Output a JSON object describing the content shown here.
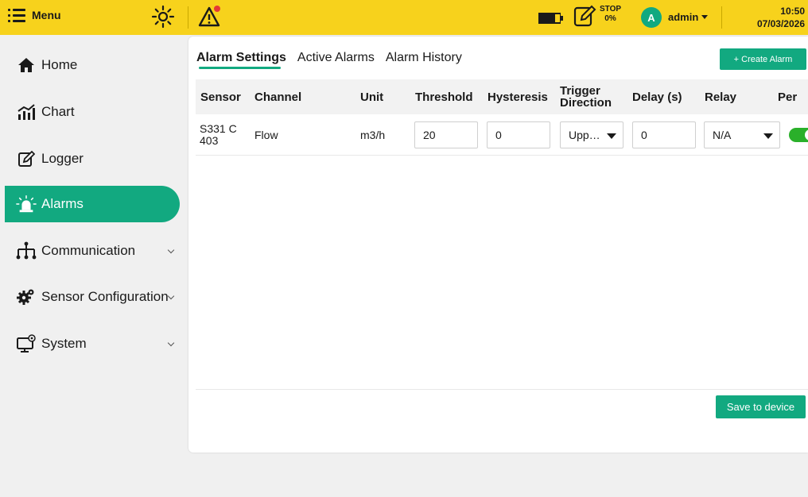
{
  "topbar": {
    "menu_label": "Menu",
    "recording_status": "STOP",
    "recording_percent": "0%",
    "avatar_initial": "A",
    "username": "admin",
    "time": "10:50",
    "date": "07/03/2026",
    "brand_color": "#f7d21c",
    "icons": [
      "menu-icon",
      "brightness-icon",
      "warning-icon",
      "battery-icon",
      "logger-status-icon"
    ]
  },
  "sidebar": {
    "items": [
      {
        "label": "Home",
        "icon": "home-icon"
      },
      {
        "label": "Chart",
        "icon": "chart-icon"
      },
      {
        "label": "Logger",
        "icon": "logger-icon"
      },
      {
        "label": "Alarms",
        "icon": "alarm-icon",
        "active": true
      },
      {
        "label": "Communication",
        "icon": "network-icon"
      },
      {
        "label": "Sensor Configuration",
        "icon": "gear-icon"
      },
      {
        "label": "System",
        "icon": "system-icon"
      }
    ],
    "accent_color": "#12a980"
  },
  "main": {
    "tabs": [
      "Alarm Settings",
      "Active Alarms",
      "Alarm History"
    ],
    "active_tab": "Alarm Settings",
    "create_button": "+ Create Alarm",
    "table": {
      "headers": [
        "Sensor",
        "Channel",
        "Unit",
        "Threshold",
        "Hysteresis",
        "Trigger Direction",
        "Delay (s)",
        "Relay",
        "Per"
      ],
      "rows": [
        {
          "sensor": "S331 C 403",
          "channel": "Flow",
          "unit": "m3/h",
          "threshold": "20",
          "hysteresis": "0",
          "trigger_direction": "Upp…",
          "delay": "0",
          "relay": "N/A",
          "enabled": true
        }
      ]
    },
    "save_button": "Save to device"
  }
}
